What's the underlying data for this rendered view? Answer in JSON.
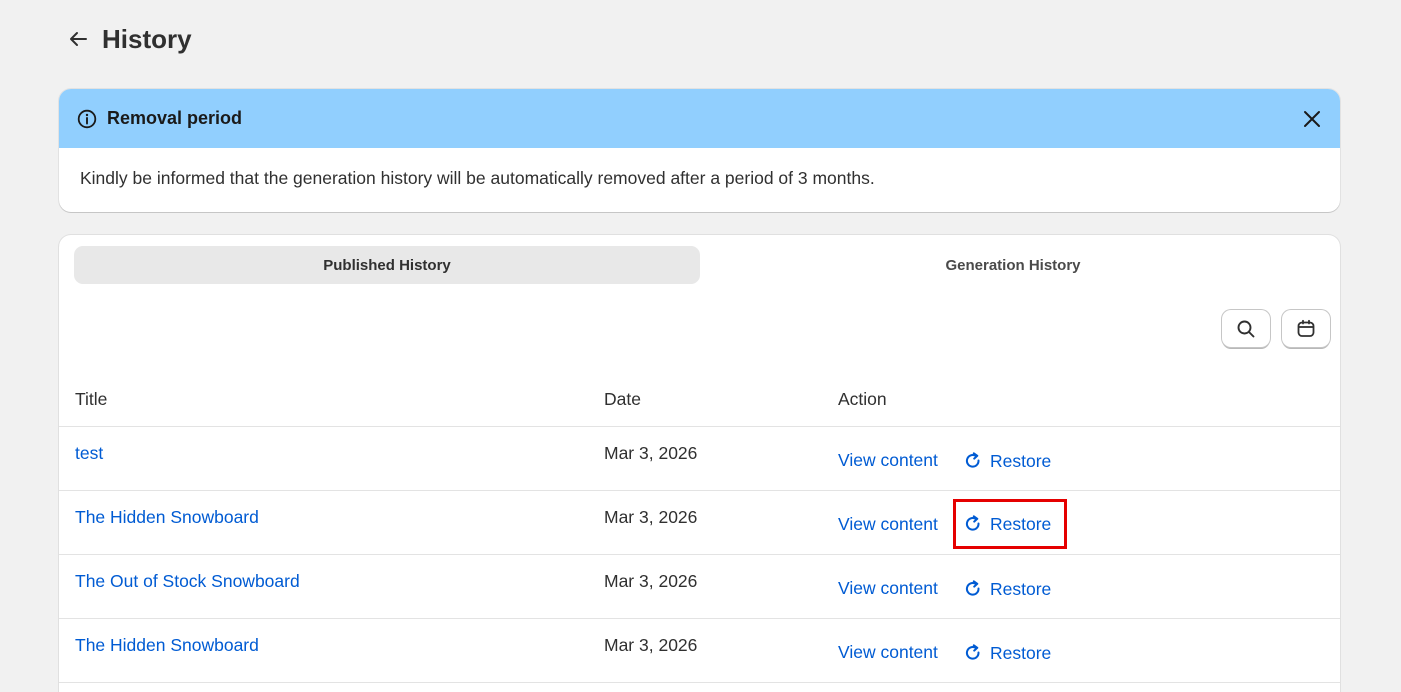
{
  "header": {
    "title": "History"
  },
  "banner": {
    "title": "Removal period",
    "message": "Kindly be informed that the generation history will be automatically removed after a period of 3 months."
  },
  "tabs": [
    {
      "label": "Published History",
      "active": true
    },
    {
      "label": "Generation History",
      "active": false
    }
  ],
  "table": {
    "columns": [
      "Title",
      "Date",
      "Action"
    ],
    "rows": [
      {
        "title": "test",
        "date": "Mar 3, 2026",
        "view": "View content",
        "restore": "Restore"
      },
      {
        "title": "The Hidden Snowboard",
        "date": "Mar 3, 2026",
        "view": "View content",
        "restore": "Restore"
      },
      {
        "title": "The Out of Stock Snowboard",
        "date": "Mar 3, 2026",
        "view": "View content",
        "restore": "Restore"
      },
      {
        "title": "The Hidden Snowboard",
        "date": "Mar 3, 2026",
        "view": "View content",
        "restore": "Restore"
      }
    ]
  },
  "colors": {
    "banner_bg": "#91cffe",
    "link": "#005bd3",
    "highlight": "#e50000",
    "page_bg": "#f1f1f1"
  }
}
